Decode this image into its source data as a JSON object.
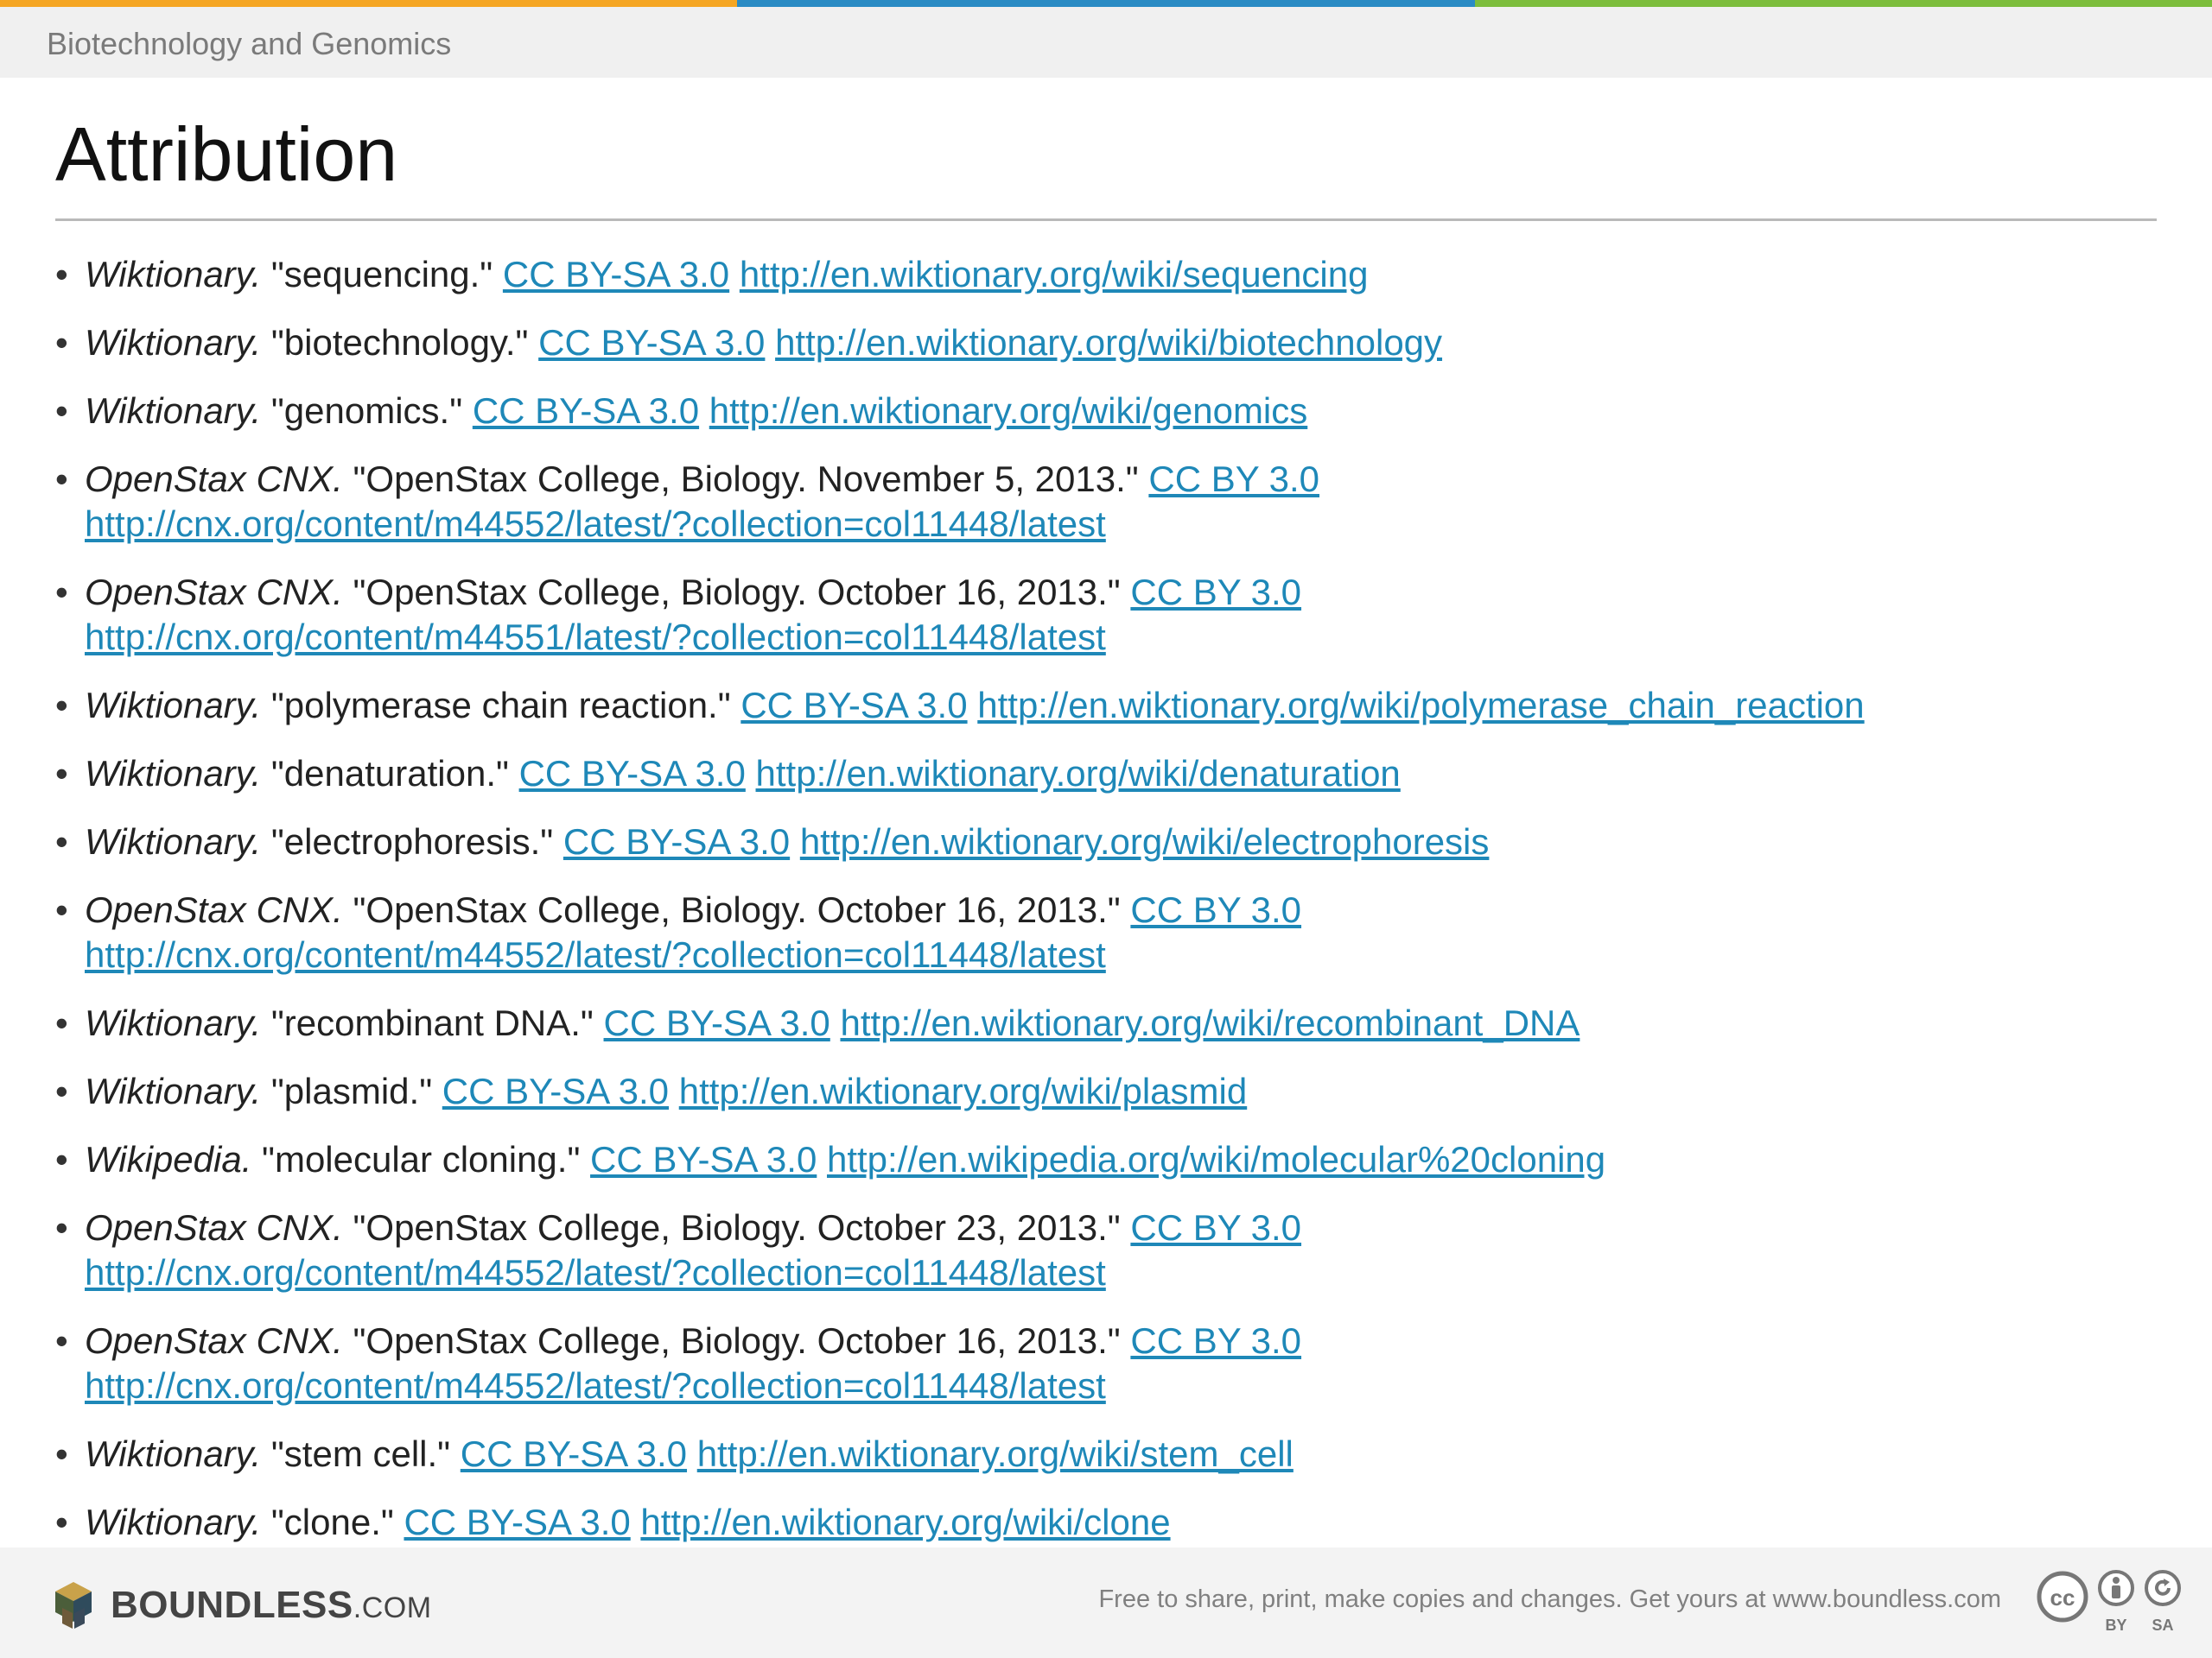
{
  "header": {
    "course": "Biotechnology and Genomics",
    "colors": [
      "#f5a623",
      "#2a8bc4",
      "#7cbd3c"
    ]
  },
  "title": "Attribution",
  "items": [
    {
      "source": "Wiktionary.",
      "text": "\"sequencing.\"",
      "license": "CC BY-SA 3.0",
      "url": "http://en.wiktionary.org/wiki/sequencing",
      "wrap": false
    },
    {
      "source": "Wiktionary.",
      "text": "\"biotechnology.\"",
      "license": "CC BY-SA 3.0",
      "url": "http://en.wiktionary.org/wiki/biotechnology",
      "wrap": false
    },
    {
      "source": "Wiktionary.",
      "text": "\"genomics.\"",
      "license": "CC BY-SA 3.0",
      "url": "http://en.wiktionary.org/wiki/genomics",
      "wrap": false
    },
    {
      "source": "OpenStax CNX.",
      "text": "\"OpenStax College, Biology. November 5, 2013.\"",
      "license": "CC BY 3.0",
      "url": "http://cnx.org/content/m44552/latest/?collection=col11448/latest",
      "wrap": true
    },
    {
      "source": "OpenStax CNX.",
      "text": "\"OpenStax College, Biology. October 16, 2013.\"",
      "license": "CC BY 3.0",
      "url": "http://cnx.org/content/m44551/latest/?collection=col11448/latest",
      "wrap": true
    },
    {
      "source": "Wiktionary.",
      "text": "\"polymerase chain reaction.\"",
      "license": "CC BY-SA 3.0",
      "url": "http://en.wiktionary.org/wiki/polymerase_chain_reaction",
      "wrap": false
    },
    {
      "source": "Wiktionary.",
      "text": "\"denaturation.\"",
      "license": "CC BY-SA 3.0",
      "url": "http://en.wiktionary.org/wiki/denaturation",
      "wrap": false
    },
    {
      "source": "Wiktionary.",
      "text": "\"electrophoresis.\"",
      "license": "CC BY-SA 3.0",
      "url": "http://en.wiktionary.org/wiki/electrophoresis",
      "wrap": false
    },
    {
      "source": "OpenStax CNX.",
      "text": "\"OpenStax College, Biology. October 16, 2013.\"",
      "license": "CC BY 3.0",
      "url": "http://cnx.org/content/m44552/latest/?collection=col11448/latest",
      "wrap": true
    },
    {
      "source": "Wiktionary.",
      "text": "\"recombinant DNA.\"",
      "license": "CC BY-SA 3.0",
      "url": "http://en.wiktionary.org/wiki/recombinant_DNA",
      "wrap": false
    },
    {
      "source": "Wiktionary.",
      "text": "\"plasmid.\"",
      "license": "CC BY-SA 3.0",
      "url": "http://en.wiktionary.org/wiki/plasmid",
      "wrap": false
    },
    {
      "source": "Wikipedia.",
      "text": "\"molecular cloning.\"",
      "license": "CC BY-SA 3.0",
      "url": "http://en.wikipedia.org/wiki/molecular%20cloning",
      "wrap": false
    },
    {
      "source": "OpenStax CNX.",
      "text": "\"OpenStax College, Biology. October 23, 2013.\"",
      "license": "CC BY 3.0",
      "url": "http://cnx.org/content/m44552/latest/?collection=col11448/latest",
      "wrap": true
    },
    {
      "source": "OpenStax CNX.",
      "text": "\"OpenStax College, Biology. October 16, 2013.\"",
      "license": "CC BY 3.0",
      "url": "http://cnx.org/content/m44552/latest/?collection=col11448/latest",
      "wrap": true
    },
    {
      "source": "Wiktionary.",
      "text": "\"stem cell.\"",
      "license": "CC BY-SA 3.0",
      "url": "http://en.wiktionary.org/wiki/stem_cell",
      "wrap": false
    },
    {
      "source": "Wiktionary.",
      "text": "\"clone.\"",
      "license": "CC BY-SA 3.0",
      "url": "http://en.wiktionary.org/wiki/clone",
      "wrap": false
    }
  ],
  "footer": {
    "logo_main": "BOUNDLESS",
    "logo_domain": ".COM",
    "note": "Free to share, print, make copies and changes. Get yours at www.boundless.com",
    "license_icons": [
      "cc-icon",
      "by-icon",
      "sa-icon"
    ],
    "icon_labels": {
      "by": "BY",
      "sa": "SA"
    }
  }
}
